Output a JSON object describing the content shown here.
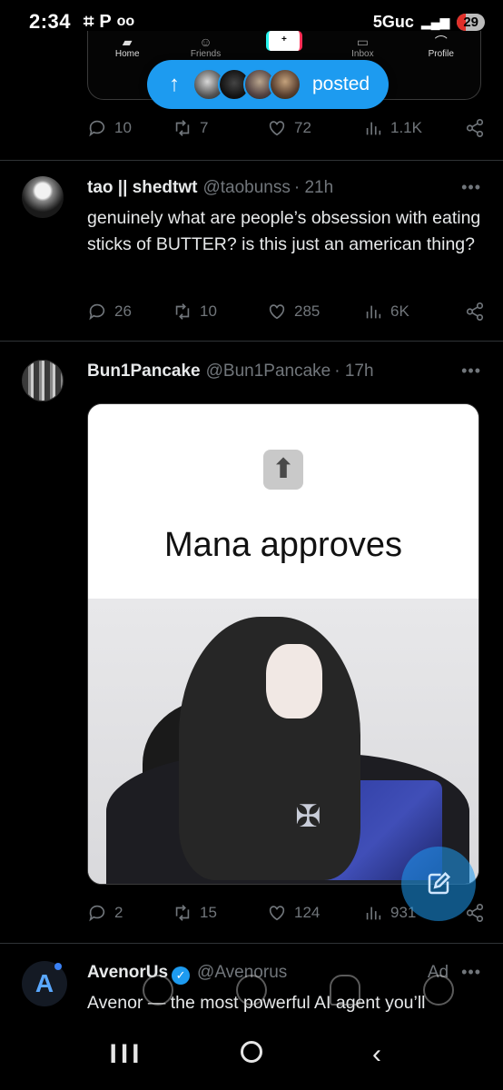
{
  "status_bar": {
    "time": "2:34",
    "left_icons": [
      "screenshot-icon",
      "p-icon",
      "voicemail-icon"
    ],
    "network": "5Guc",
    "battery": "29"
  },
  "embed_nav": {
    "items": [
      {
        "label": "Home",
        "icon": "home-icon"
      },
      {
        "label": "Friends",
        "icon": "friends-icon"
      },
      {
        "label": "+",
        "icon": "create-icon"
      },
      {
        "label": "Inbox",
        "icon": "inbox-icon"
      },
      {
        "label": "Profile",
        "icon": "profile-icon"
      }
    ]
  },
  "posted_pill": {
    "arrow": "↑",
    "label": "posted"
  },
  "tweet0_actions": {
    "replies": "10",
    "retweets": "7",
    "likes": "72",
    "views": "1.1K"
  },
  "tweet1": {
    "name": "tao || shedtwt",
    "handle": "@taobunss",
    "time": "· 21h",
    "text": "genuinely what are people’s obsession with eating sticks of BUTTER? is this just an american thing?",
    "replies": "26",
    "retweets": "10",
    "likes": "285",
    "views": "6K"
  },
  "tweet2": {
    "name": "Bun1Pancake",
    "handle": "@Bun1Pancake",
    "time": "· 17h",
    "image_caption": "Mana approves",
    "emoji": "⬆",
    "replies": "2",
    "retweets": "15",
    "likes": "124",
    "views": "931"
  },
  "ad": {
    "name": "AvenorUs",
    "handle": "@Avenorus",
    "tag": "Ad",
    "text": "Avenor — the most powerful AI agent you’ll",
    "logo": "A"
  },
  "more_glyph": "•••",
  "android_nav": {
    "recents": "III",
    "back": "‹"
  },
  "colors": {
    "accent": "#1d9bf0",
    "background": "#000000",
    "muted": "#71767b"
  }
}
